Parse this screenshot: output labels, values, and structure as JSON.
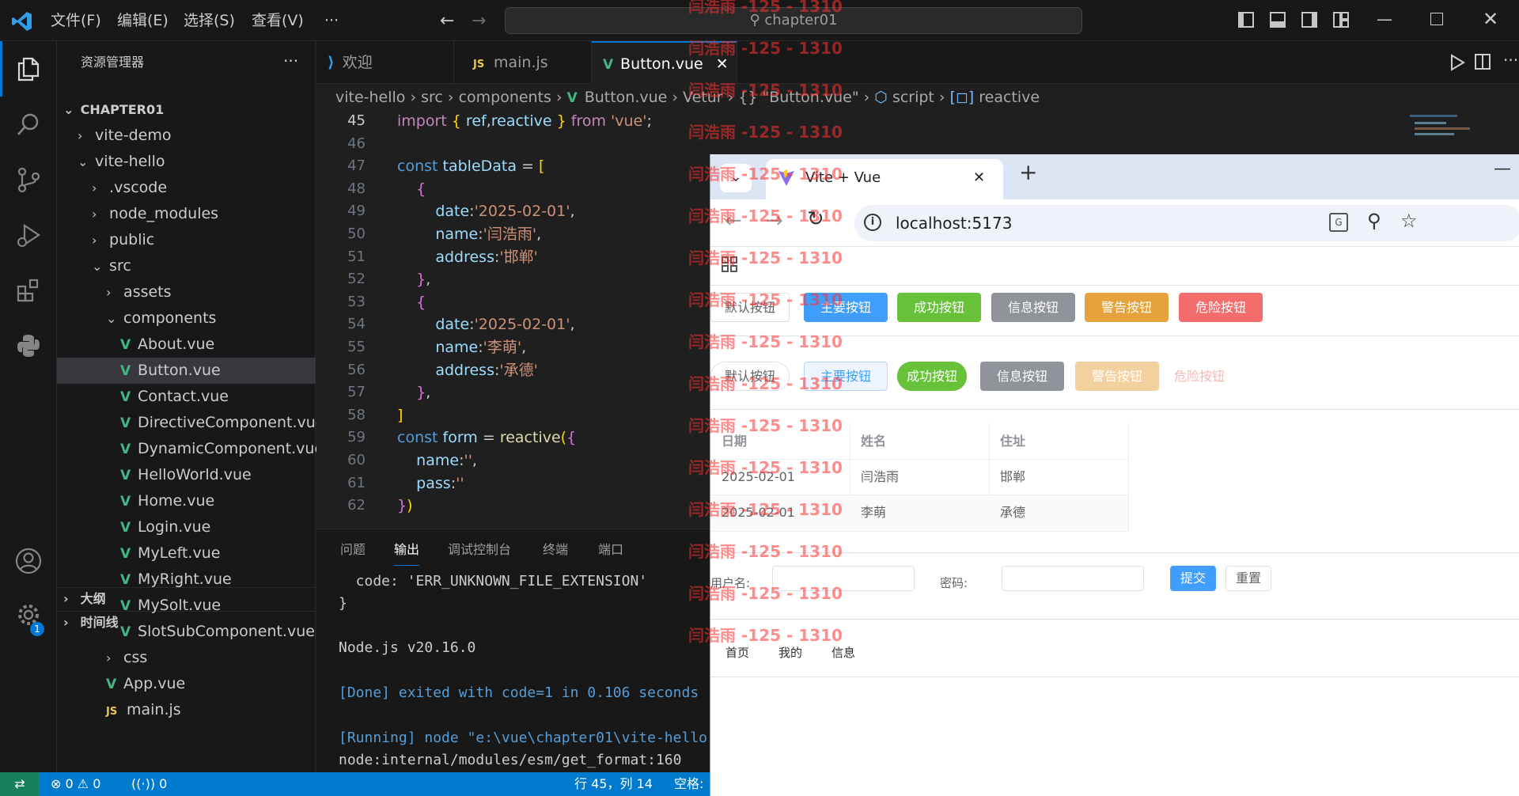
{
  "window": {
    "menu": [
      "文件(F)",
      "编辑(E)",
      "选择(S)",
      "查看(V)",
      "···"
    ],
    "search": "chapter01"
  },
  "sidebar": {
    "title": "资源管理器",
    "root": "CHAPTER01",
    "items": [
      "vite-demo",
      "vite-hello",
      ".vscode",
      "node_modules",
      "public",
      "src",
      "assets",
      "components",
      "About.vue",
      "Button.vue",
      "Contact.vue",
      "DirectiveComponent.vue",
      "DynamicComponent.vue",
      "HelloWorld.vue",
      "Home.vue",
      "Login.vue",
      "MyLeft.vue",
      "MyRight.vue",
      "MySolt.vue",
      "SlotSubComponent.vue",
      "css",
      "App.vue",
      "main.js"
    ],
    "outline": "大纲",
    "timeline": "时间线",
    "settings_badge": "1"
  },
  "tabs": [
    {
      "label": "欢迎",
      "icon": "vscode-icon"
    },
    {
      "label": "main.js",
      "icon": "js-icon"
    },
    {
      "label": "Button.vue",
      "icon": "vue-icon",
      "active": true
    }
  ],
  "breadcrumb": [
    "vite-hello",
    "src",
    "components",
    "Button.vue",
    "Vetur",
    "{} \"Button.vue\"",
    "script",
    "reactive"
  ],
  "editor": {
    "line_numbers": [
      "45",
      "46",
      "47",
      "48",
      "49",
      "50",
      "51",
      "52",
      "53",
      "54",
      "55",
      "56",
      "57",
      "58",
      "59",
      "60",
      "61",
      "62"
    ]
  },
  "panel": {
    "tabs": [
      "问题",
      "输出",
      "调试控制台",
      "终端",
      "端口"
    ],
    "active_tab": "输出",
    "lines": [
      "  code: 'ERR_UNKNOWN_FILE_EXTENSION'",
      "}",
      "",
      "Node.js v20.16.0",
      "",
      "[Done] exited with code=1 in 0.106 seconds",
      "",
      "[Running] node \"e:\\vue\\chapter01\\vite-hello",
      "node:internal/modules/esm/get_format:160"
    ]
  },
  "status": {
    "errors": "0",
    "warnings": "0",
    "ports": "0",
    "position": "行 45，列 14",
    "spaces": "空格:"
  },
  "browser": {
    "tab_title": "Vite + Vue",
    "url": "localhost:5173",
    "buttons_row1": [
      "默认按钮",
      "主要按钮",
      "成功按钮",
      "信息按钮",
      "警告按钮",
      "危险按钮"
    ],
    "buttons_row2": [
      "默认按钮",
      "主要按钮",
      "成功按钮",
      "信息按钮",
      "警告按钮",
      "危险按钮"
    ],
    "table": {
      "headers": [
        "日期",
        "姓名",
        "住址"
      ],
      "rows": [
        [
          "2025-02-01",
          "闫浩雨",
          "邯郸"
        ],
        [
          "2025-02-01",
          "李萌",
          "承德"
        ]
      ]
    },
    "form": {
      "user_label": "用户名:",
      "pass_label": "密码:",
      "submit": "提交",
      "reset": "重置"
    },
    "nav": [
      "首页",
      "我的",
      "信息"
    ]
  },
  "watermark": "闫浩雨 -125 - 1310",
  "colors": {
    "accent": "#007acc",
    "primary": "#409eff",
    "success": "#67c23a",
    "info": "#909399",
    "warning": "#e6a23c",
    "danger": "#f56c6c"
  }
}
